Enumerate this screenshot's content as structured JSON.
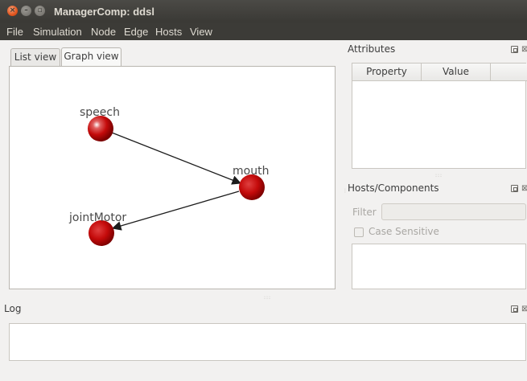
{
  "window": {
    "title": "ManagerComp: ddsl"
  },
  "menu": [
    "File",
    "Simulation",
    "Node",
    "Edge",
    "Hosts",
    "View"
  ],
  "tabs": [
    {
      "label": "List view",
      "active": false
    },
    {
      "label": "Graph view",
      "active": true
    }
  ],
  "graph": {
    "nodes": {
      "speech": "speech",
      "mouth": "mouth",
      "jointMotor": "jointMotor"
    },
    "edges": [
      {
        "from": "speech",
        "to": "mouth"
      },
      {
        "from": "mouth",
        "to": "jointMotor"
      }
    ],
    "node_color": "#c40a0a",
    "edge_color": "#1c1c1c"
  },
  "attributes": {
    "title": "Attributes",
    "columns": [
      "Property",
      "Value"
    ],
    "rows": []
  },
  "hosts": {
    "title": "Hosts/Components",
    "filter_label": "Filter",
    "filter_value": "",
    "case_sensitive_label": "Case Sensitive",
    "case_sensitive_checked": false
  },
  "log": {
    "title": "Log",
    "text": ""
  },
  "colors": {
    "titlebar": "#3c3b37",
    "menu_text": "#dfdbd2",
    "close_button": "#e1561f",
    "panel_bg": "#f2f1f0"
  }
}
